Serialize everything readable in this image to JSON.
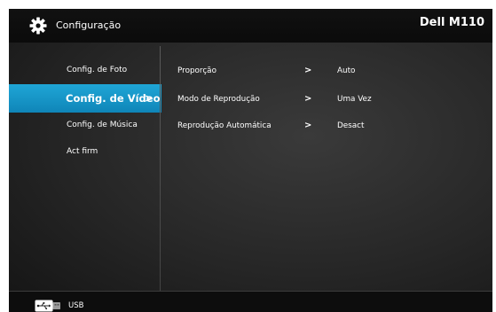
{
  "header": {
    "title": "Configuração",
    "brand": "Dell M110",
    "icon": "gear-icon"
  },
  "sidebar": {
    "items": [
      {
        "label": "Config. de Foto",
        "active": false
      },
      {
        "label": "Config. de Vídeo",
        "active": true,
        "chevron": ">"
      },
      {
        "label": "Config. de Música",
        "active": false
      },
      {
        "label": "Act firm",
        "active": false
      }
    ]
  },
  "settings": {
    "rows": [
      {
        "name": "Proporção",
        "chevron": ">",
        "value": "Auto"
      },
      {
        "name": "Modo de Reprodução",
        "chevron": ">",
        "value": "Uma Vez"
      },
      {
        "name": "Reprodução Automática",
        "chevron": ">",
        "value": "Desact"
      }
    ]
  },
  "footer": {
    "source_label": "USB",
    "icon": "usb-icon"
  },
  "colors": {
    "accent": "#1b9ccf",
    "background": "#2a2a2a",
    "text": "#ffffff"
  }
}
